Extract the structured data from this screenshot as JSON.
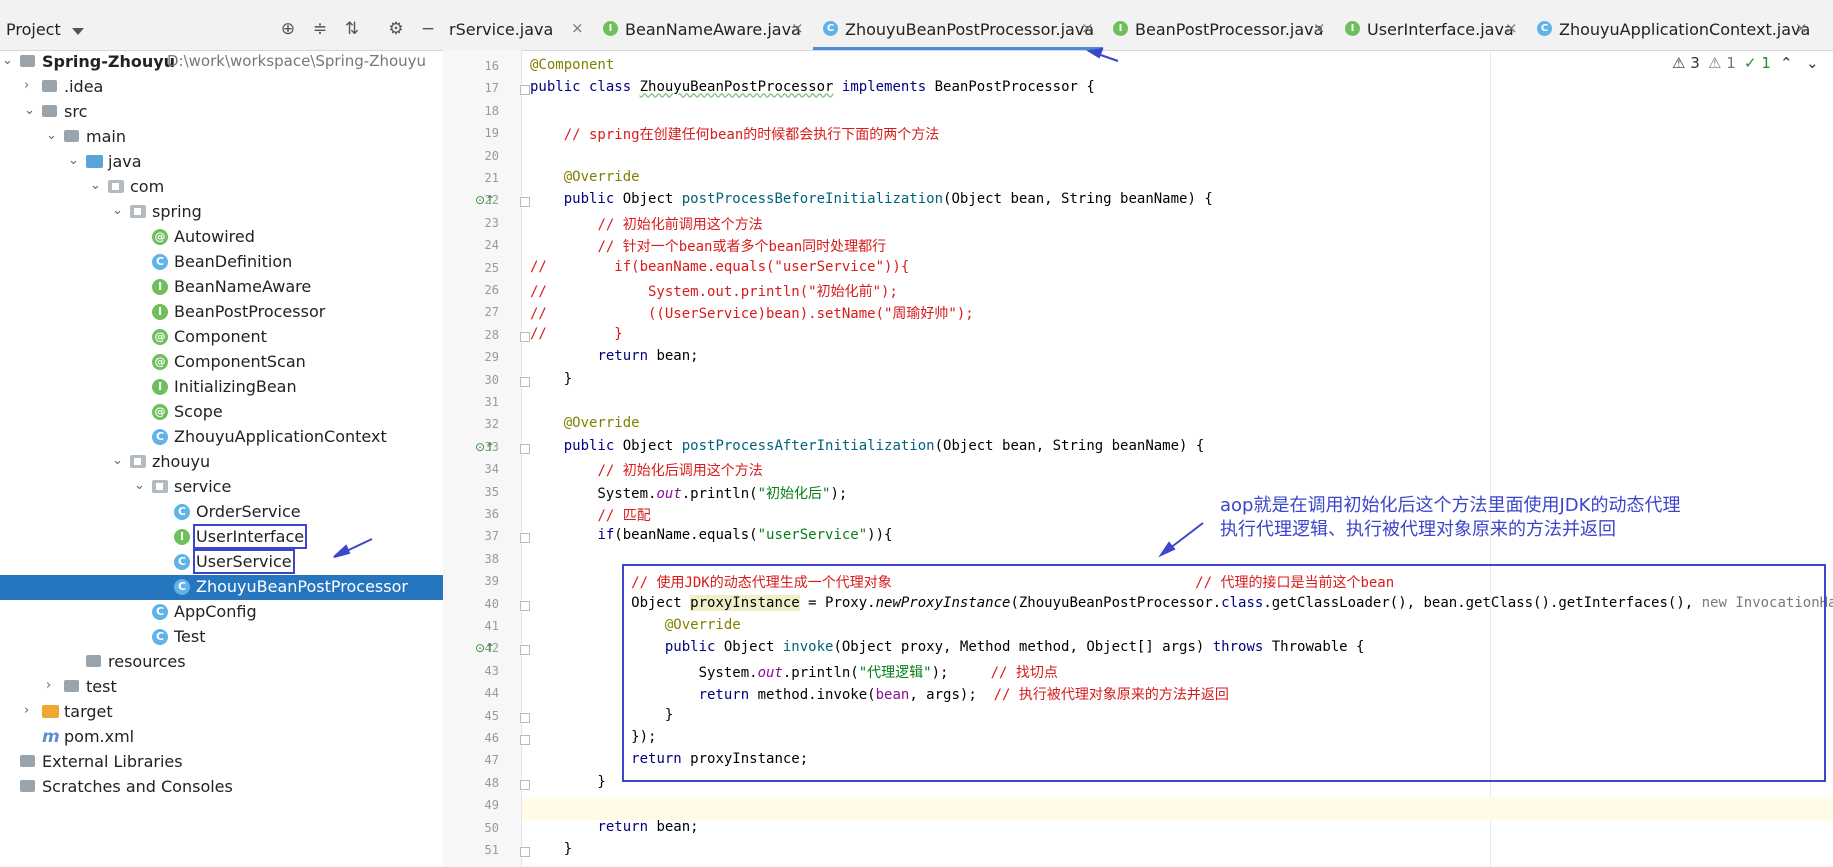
{
  "project_panel": {
    "title": "Project",
    "tree": [
      {
        "label": "Spring-Zhouyu",
        "path": "D:\\work\\workspace\\Spring-Zhouyu",
        "kind": "module",
        "level": 0,
        "expanded": true
      },
      {
        "label": ".idea",
        "kind": "folder",
        "level": 1,
        "expanded": false
      },
      {
        "label": "src",
        "kind": "folder",
        "level": 1,
        "expanded": true
      },
      {
        "label": "main",
        "kind": "folder",
        "level": 2,
        "expanded": true
      },
      {
        "label": "java",
        "kind": "source-folder",
        "level": 3,
        "expanded": true
      },
      {
        "label": "com",
        "kind": "package",
        "level": 4,
        "expanded": true
      },
      {
        "label": "spring",
        "kind": "package",
        "level": 5,
        "expanded": true
      },
      {
        "label": "Autowired",
        "kind": "annotation",
        "level": 6
      },
      {
        "label": "BeanDefinition",
        "kind": "class",
        "level": 6
      },
      {
        "label": "BeanNameAware",
        "kind": "interface",
        "level": 6
      },
      {
        "label": "BeanPostProcessor",
        "kind": "interface",
        "level": 6
      },
      {
        "label": "Component",
        "kind": "annotation",
        "level": 6
      },
      {
        "label": "ComponentScan",
        "kind": "annotation",
        "level": 6
      },
      {
        "label": "InitializingBean",
        "kind": "interface",
        "level": 6
      },
      {
        "label": "Scope",
        "kind": "annotation",
        "level": 6
      },
      {
        "label": "ZhouyuApplicationContext",
        "kind": "class",
        "level": 6
      },
      {
        "label": "zhouyu",
        "kind": "package",
        "level": 5,
        "expanded": true
      },
      {
        "label": "service",
        "kind": "package",
        "level": 6,
        "expanded": true
      },
      {
        "label": "OrderService",
        "kind": "class",
        "level": 7
      },
      {
        "label": "UserInterface",
        "kind": "interface",
        "level": 7,
        "boxed": true
      },
      {
        "label": "UserService",
        "kind": "class",
        "level": 7,
        "boxed": true
      },
      {
        "label": "ZhouyuBeanPostProcessor",
        "kind": "class",
        "level": 7,
        "selected": true
      },
      {
        "label": "AppConfig",
        "kind": "class",
        "level": 6
      },
      {
        "label": "Test",
        "kind": "class-test",
        "level": 6
      },
      {
        "label": "resources",
        "kind": "folder",
        "level": 3
      },
      {
        "label": "test",
        "kind": "folder",
        "level": 2,
        "expanded": false
      },
      {
        "label": "target",
        "kind": "folder-orange",
        "level": 1,
        "expanded": false
      },
      {
        "label": "pom.xml",
        "kind": "maven",
        "level": 1
      },
      {
        "label": "External Libraries",
        "kind": "library",
        "level": 0
      },
      {
        "label": "Scratches and Consoles",
        "kind": "scratch",
        "level": 0
      }
    ]
  },
  "editor": {
    "tabs": [
      {
        "label": "rService.java",
        "icon": "",
        "active": false
      },
      {
        "label": "BeanNameAware.java",
        "icon": "I",
        "active": false
      },
      {
        "label": "ZhouyuBeanPostProcessor.java",
        "icon": "C",
        "active": true
      },
      {
        "label": "BeanPostProcessor.java",
        "icon": "I",
        "active": false
      },
      {
        "label": "UserInterface.java",
        "icon": "I",
        "active": false
      },
      {
        "label": "ZhouyuApplicationContext.java",
        "icon": "C",
        "active": false
      }
    ],
    "inspections": {
      "warnings": "3",
      "weak_warnings": "1",
      "ok": "1"
    },
    "annotation_text": [
      "aop就是在调用初始化后这个方法里面使用JDK的动态代理",
      "执行代理逻辑、执行被代理对象原来的方法并返回"
    ],
    "lines": [
      {
        "n": "16",
        "html": "<span class=\"an\">@Component</span>"
      },
      {
        "n": "17",
        "html": "<span class=\"kw\">public class</span> <span class=\"wavy\">ZhouyuBeanPostProcessor</span> <span class=\"kw\">implements</span> BeanPostProcessor {"
      },
      {
        "n": "18",
        "html": ""
      },
      {
        "n": "19",
        "html": "    <span class=\"cm\">// spring在创建任何bean的时候都会执行下面的两个方法</span>"
      },
      {
        "n": "20",
        "html": ""
      },
      {
        "n": "21",
        "html": "    <span class=\"an\">@Override</span>"
      },
      {
        "n": "22",
        "html": "    <span class=\"kw\">public</span> Object <span class=\"fn\">postProcessBeforeInitialization</span>(Object bean, String beanName) {"
      },
      {
        "n": "23",
        "html": "        <span class=\"cm\">// 初始化前调用这个方法</span>"
      },
      {
        "n": "24",
        "html": "        <span class=\"cm\">// 针对一个bean或者多个bean同时处理都行</span>"
      },
      {
        "n": "25",
        "html": "<span class=\"cm\">//        if(beanName.equals(\"userService\")){</span>"
      },
      {
        "n": "26",
        "html": "<span class=\"cm\">//            System.out.println(\"初始化前\");</span>"
      },
      {
        "n": "27",
        "html": "<span class=\"cm\">//            ((UserService)bean).setName(\"周瑜好帅\");</span>"
      },
      {
        "n": "28",
        "html": "<span class=\"cm\">//        }</span>"
      },
      {
        "n": "29",
        "html": "        <span class=\"kw\">return</span> bean;"
      },
      {
        "n": "30",
        "html": "    }"
      },
      {
        "n": "31",
        "html": ""
      },
      {
        "n": "32",
        "html": "    <span class=\"an\">@Override</span>"
      },
      {
        "n": "33",
        "html": "    <span class=\"kw\">public</span> Object <span class=\"fn\">postProcessAfterInitialization</span>(Object bean, String beanName) {"
      },
      {
        "n": "34",
        "html": "        <span class=\"cm\">// 初始化后调用这个方法</span>"
      },
      {
        "n": "35",
        "html": "        System.<span class=\"it\" style=\"color:#871094\">out</span>.println(<span class=\"st\">\"初始化后\"</span>);"
      },
      {
        "n": "36",
        "html": "        <span class=\"cm\">// 匹配</span>"
      },
      {
        "n": "37",
        "html": "        <span class=\"kw\">if</span>(beanName.equals(<span class=\"st\">\"userService\"</span>)){"
      },
      {
        "n": "38",
        "html": ""
      },
      {
        "n": "39",
        "html": "            <span class=\"cm\">// 使用JDK的动态代理生成一个代理对象                                    // 代理的接口是当前这个bean</span>"
      },
      {
        "n": "40",
        "html": "            Object <span style=\"background:#f0f0c8\">proxyInstance</span> = Proxy.<span class=\"it\">newProxyInstance</span>(ZhouyuBeanPostProcessor.<span class=\"kw\">class</span>.getClassLoader(), bean.getClass().getInterfaces(), <span class=\"cl\">new InvocationHandler()</span>"
      },
      {
        "n": "41",
        "html": "                <span class=\"an\">@Override</span>"
      },
      {
        "n": "42",
        "html": "                <span class=\"kw\">public</span> Object <span class=\"fn\">invoke</span>(Object proxy, Method method, Object[] args) <span class=\"kw\">throws</span> Throwable {"
      },
      {
        "n": "43",
        "html": "                    System.<span class=\"it\" style=\"color:#871094\">out</span>.println(<span class=\"st\">\"代理逻辑\"</span>);     <span class=\"cm\">// 找切点</span>"
      },
      {
        "n": "44",
        "html": "                    <span class=\"kw\">return</span> method.invoke(<span style=\"color:#871094\">bean</span>, args);  <span class=\"cm\">// 执行被代理对象原来的方法并返回</span>"
      },
      {
        "n": "45",
        "html": "                }"
      },
      {
        "n": "46",
        "html": "            });"
      },
      {
        "n": "47",
        "html": "            <span class=\"kw\">return</span> proxyInstance;"
      },
      {
        "n": "48",
        "html": "        }"
      },
      {
        "n": "49",
        "html": ""
      },
      {
        "n": "50",
        "html": "        <span class=\"kw\">return</span> bean;"
      },
      {
        "n": "51",
        "html": "    }"
      }
    ]
  }
}
